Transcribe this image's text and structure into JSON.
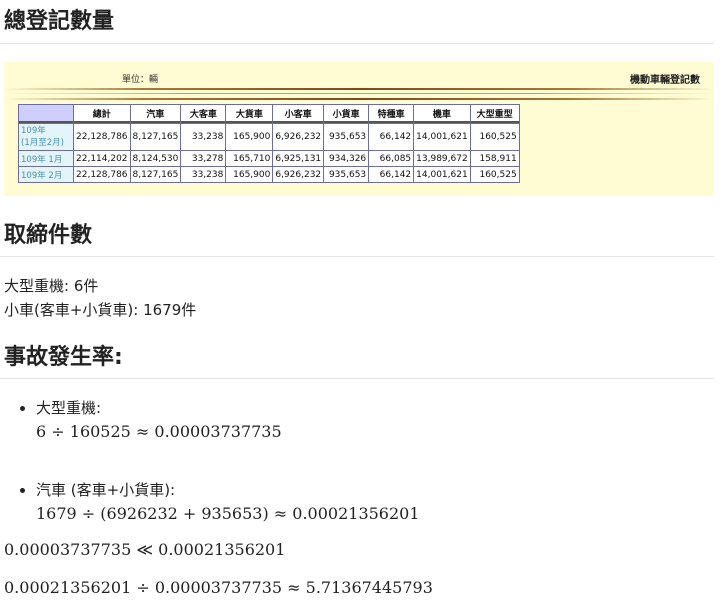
{
  "sections": {
    "registration_title": "總登記數量",
    "enforcement_title": "取締件數",
    "accident_title": "事故發生率:"
  },
  "panel": {
    "unit_label": "單位：輛",
    "title": "機動車輛登記數",
    "header_colors": {
      "panel_bg": "#fffbd2",
      "table_border": "#6c6ca0",
      "row_header_text": "#4a8fb3"
    },
    "columns": [
      "總計",
      "汽車",
      "大客車",
      "大貨車",
      "小客車",
      "小貨車",
      "特種車",
      "機車",
      "大型重型"
    ],
    "rows": [
      {
        "label": "109年(1月至2月)",
        "cells": [
          "22,128,786",
          "8,127,165",
          "33,238",
          "165,900",
          "6,926,232",
          "935,653",
          "66,142",
          "14,001,621",
          "160,525"
        ]
      },
      {
        "label": "109年 1月",
        "cells": [
          "22,114,202",
          "8,124,530",
          "33,278",
          "165,710",
          "6,925,131",
          "934,326",
          "66,085",
          "13,989,672",
          "158,911"
        ]
      },
      {
        "label": "109年 2月",
        "cells": [
          "22,128,786",
          "8,127,165",
          "33,238",
          "165,900",
          "6,926,232",
          "935,653",
          "66,142",
          "14,001,621",
          "160,525"
        ]
      }
    ]
  },
  "enforcement": {
    "heavy": "大型重機: 6件",
    "small": "小車(客車+小貨車): 1679件"
  },
  "accidents": {
    "item1_label": "大型重機:",
    "item1_formula": "6 ÷ 160525 ≈ 0.00003737735",
    "item2_label": "汽車 (客車+小貨車):",
    "item2_formula": "1679 ÷ (6926232 + 935653) ≈ 0.00021356201",
    "comparison": "0.00003737735 ≪ 0.00021356201",
    "ratio": "0.00021356201 ÷ 0.00003737735 ≈ 5.71367445793"
  }
}
